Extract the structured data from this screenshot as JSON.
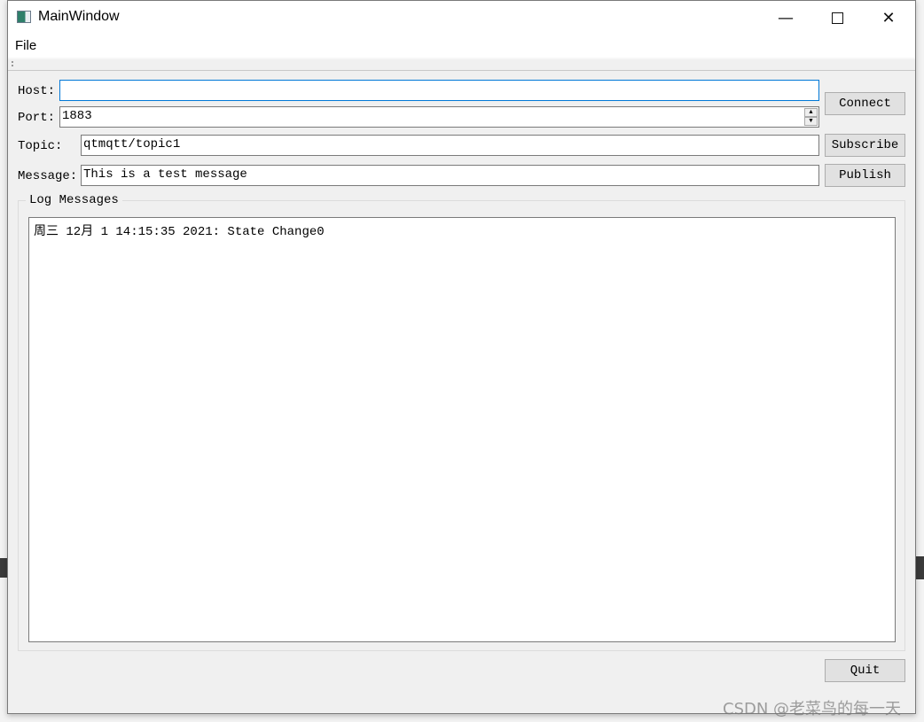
{
  "window": {
    "title": "MainWindow",
    "minimize_icon": "minimize-icon",
    "maximize_icon": "maximize-icon",
    "close_icon": "close-icon"
  },
  "menu": {
    "file": "File"
  },
  "form": {
    "host_label": "Host:",
    "host_value": "",
    "port_label": "Port:",
    "port_value": "1883",
    "topic_label": "Topic:",
    "topic_value": "qtmqtt/topic1",
    "message_label": "Message:",
    "message_value": "This is a test message"
  },
  "buttons": {
    "connect": "Connect",
    "subscribe": "Subscribe",
    "publish": "Publish",
    "quit": "Quit"
  },
  "log": {
    "title": "Log Messages",
    "lines": [
      "周三 12月 1 14:15:35 2021: State Change0"
    ]
  },
  "watermark": "CSDN @老菜鸟的每一天",
  "colors": {
    "focus_border": "#0078d7",
    "window_bg": "#f0f0f0",
    "button_bg": "#e1e1e1"
  }
}
